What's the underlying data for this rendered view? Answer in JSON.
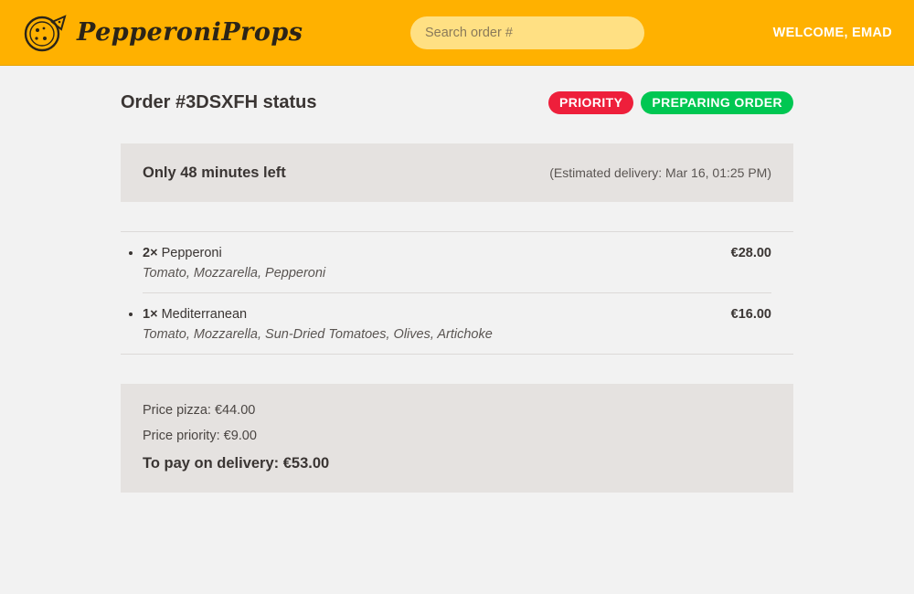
{
  "header": {
    "brand": "PepperoniProps",
    "logo_icon": "pizza-icon",
    "search_placeholder": "Search order #",
    "welcome": "WELCOME, EMAD",
    "background_color": "#ffb100"
  },
  "order": {
    "title": "Order #3DSXFH status",
    "badges": {
      "priority": "PRIORITY",
      "status": "PREPARING ORDER"
    },
    "eta": {
      "time_left": "Only 48 minutes left",
      "estimated": "(Estimated delivery: Mar 16, 01:25 PM)"
    },
    "items": [
      {
        "qty": "2×",
        "name": "Pepperoni",
        "price": "€28.00",
        "ingredients": "Tomato, Mozzarella, Pepperoni"
      },
      {
        "qty": "1×",
        "name": "Mediterranean",
        "price": "€16.00",
        "ingredients": "Tomato, Mozzarella, Sun-Dried Tomatoes, Olives, Artichoke"
      }
    ],
    "summary": {
      "price_pizza": "Price pizza: €44.00",
      "price_priority": "Price priority: €9.00",
      "total": "To pay on delivery: €53.00"
    }
  },
  "colors": {
    "priority_badge": "#ee1f3b",
    "status_badge": "#00c752",
    "panel": "#e5e2e0"
  }
}
